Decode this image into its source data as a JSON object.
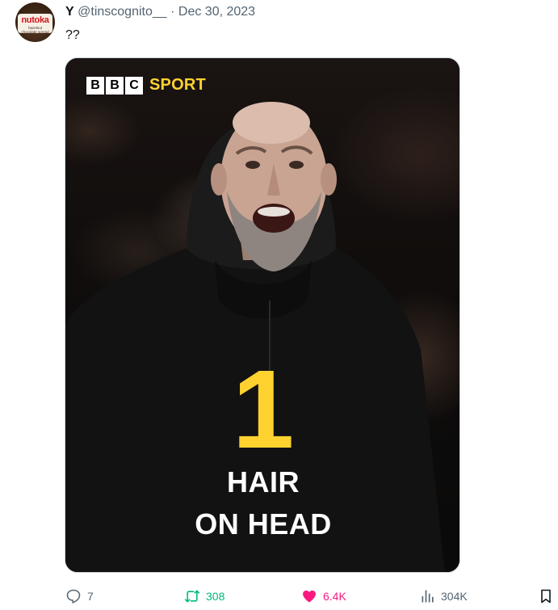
{
  "author": {
    "name": "Y",
    "handle": "@tinscognito__",
    "separator": "·",
    "date": "Dec 30, 2023",
    "avatar_icon": "nutella-jar-avatar",
    "avatar_brand": "nutoka",
    "avatar_sub": "hazelnut chocolate spread"
  },
  "tweet": {
    "text": "??"
  },
  "media": {
    "logo_blocks": [
      "B",
      "B",
      "C"
    ],
    "logo_word": "SPORT",
    "number": "1",
    "caption_line1": "HAIR",
    "caption_line2": "ON HEAD",
    "accent_color": "#ffd230"
  },
  "actions": {
    "replies": "7",
    "retweets": "308",
    "likes": "6.4K",
    "views": "304K",
    "icons": [
      "reply-icon",
      "retweet-icon",
      "like-icon",
      "views-icon",
      "bookmark-icon"
    ],
    "colors": {
      "muted": "#536471",
      "retweet": "#00ba7c",
      "like": "#f91880"
    }
  }
}
